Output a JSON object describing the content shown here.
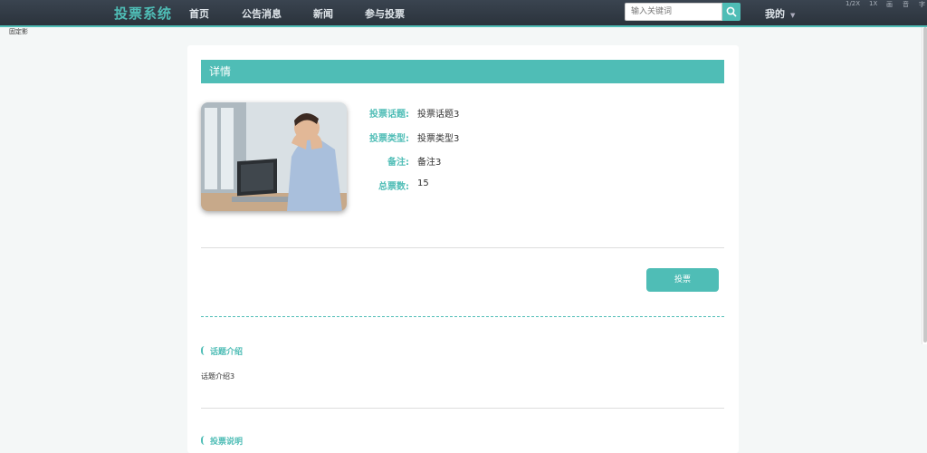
{
  "nav": {
    "brand": "投票系统",
    "menu": [
      "首页",
      "公告消息",
      "新闻",
      "参与投票"
    ],
    "search_placeholder": "输入关键词",
    "mine": "我的",
    "accessibility": [
      "1/2X",
      "1X",
      "画",
      "音",
      "字"
    ]
  },
  "top_left_text": "固定影",
  "detail": {
    "header": "详情",
    "fields": [
      {
        "label": "投票话题:",
        "value": "投票话题3"
      },
      {
        "label": "投票类型:",
        "value": "投票类型3"
      },
      {
        "label": "备注:",
        "value": "备注3"
      },
      {
        "label": "总票数:",
        "value": "15"
      }
    ],
    "vote_button": "投票"
  },
  "sections": [
    {
      "title": "话题介绍",
      "body": "话题介绍3"
    },
    {
      "title": "投票说明",
      "body": ""
    }
  ],
  "colors": {
    "accent": "#4fbdb6",
    "nav_bg": "#2f3842"
  },
  "icons": {
    "search": "search-icon",
    "caret": "chevron-down-icon"
  }
}
